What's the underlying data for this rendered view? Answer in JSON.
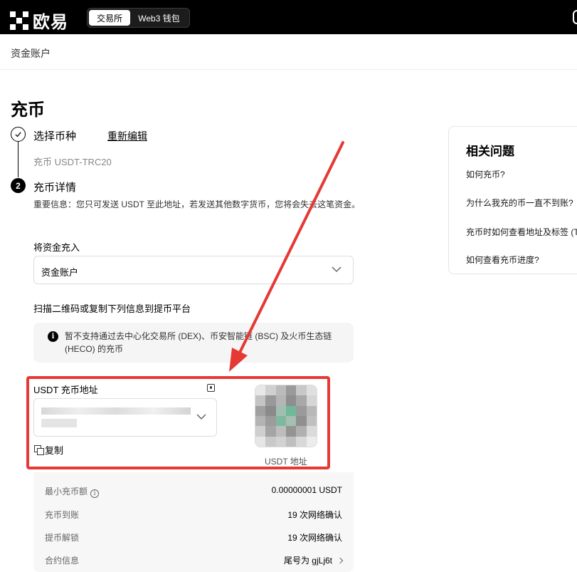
{
  "topbar": {
    "logo_text": "欧易",
    "tabs": [
      {
        "label": "交易所",
        "active": true
      },
      {
        "label": "Web3 钱包",
        "active": false
      }
    ]
  },
  "breadcrumb": "资金账户",
  "page_title": "充币",
  "step1": {
    "label": "选择币种",
    "edit_link": "重新编辑",
    "selected": "充币 USDT-TRC20"
  },
  "step2": {
    "number": "2",
    "label": "充币详情",
    "notice": "重要信息：您只可发送 USDT 至此地址，若发送其他数字货币，您将会失去这笔资金。"
  },
  "deposit_to": {
    "label": "将资金充入",
    "value": "资金账户"
  },
  "scan_label": "扫描二维码或复制下列信息到提币平台",
  "info_box": {
    "text": "暂不支持通过去中心化交易所 (DEX)、币安智能链 (BSC) 及火币生态链 (HECO) 的充币"
  },
  "address": {
    "label": "USDT 充币地址",
    "copy_label": "复制",
    "qr_caption": "USDT 地址"
  },
  "details": [
    {
      "key": "最小充币额",
      "value": "0.00000001 USDT",
      "info": true
    },
    {
      "key": "充币到账",
      "value": "19 次网络确认"
    },
    {
      "key": "提币解锁",
      "value": "19 次网络确认"
    },
    {
      "key": "合约信息",
      "value": "尾号为 gjLj6t",
      "arrow": true
    }
  ],
  "faq": {
    "title": "相关问题",
    "items": [
      "如何充币?",
      "为什么我充的币一直不到账?",
      "充币时如何查看地址及标签 (T",
      "如何查看充币进度?"
    ]
  },
  "colors": {
    "accent_red": "#e53935",
    "topbar": "#000000"
  }
}
